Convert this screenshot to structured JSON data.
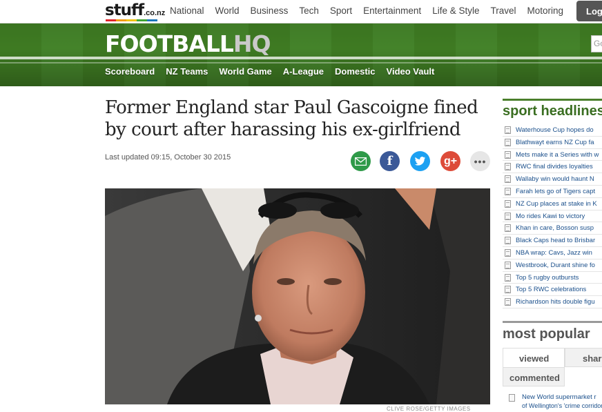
{
  "site": {
    "logo_word": "stuff",
    "logo_domain": ".co.nz",
    "nav": [
      "National",
      "World",
      "Business",
      "Tech",
      "Sport",
      "Entertainment",
      "Life & Style",
      "Travel",
      "Motoring"
    ],
    "login_label": "Log",
    "search_placeholder": "Go"
  },
  "section": {
    "brand_main": "FOOTBALL",
    "brand_suffix": "HQ",
    "subnav": [
      "Scoreboard",
      "NZ Teams",
      "World Game",
      "A-League",
      "Domestic",
      "Video Vault"
    ]
  },
  "article": {
    "headline": "Former England star Paul Gascoigne fined by court after harassing his ex-girlfriend",
    "updated": "Last updated 09:15, October 30 2015",
    "share_icons": [
      "email-icon",
      "facebook-icon",
      "twitter-icon",
      "google-plus-icon",
      "more-icon"
    ],
    "photo_credit": "CLIVE ROSE/GETTY IMAGES"
  },
  "sidebar": {
    "sport_title": "sport headlines",
    "headlines": [
      "Waterhouse Cup hopes do",
      "Blathwayt earns NZ Cup fa",
      "Mets make it a Series with w",
      "RWC final divides loyalties",
      "Wallaby win would haunt N",
      "Farah lets go of Tigers capt",
      "NZ Cup places at stake in K",
      "Mo rides Kawi to victory",
      "Khan in care, Bosson susp",
      "Black Caps head to Brisbar",
      "NBA wrap: Cavs, Jazz win",
      "Westbrook, Durant shine fo",
      "Top 5 rugby outbursts",
      "Top 5 RWC celebrations",
      "Richardson hits double figu"
    ],
    "popular_title": "most popular",
    "tabs": {
      "viewed": "viewed",
      "shared": "shared",
      "commented": "commented"
    },
    "popular_first": "New World supermarket r",
    "popular_first_cont": "of Wellington's 'crime corridor"
  },
  "colors": {
    "green_accent": "#3a6e21",
    "link": "#1a4f8b"
  }
}
